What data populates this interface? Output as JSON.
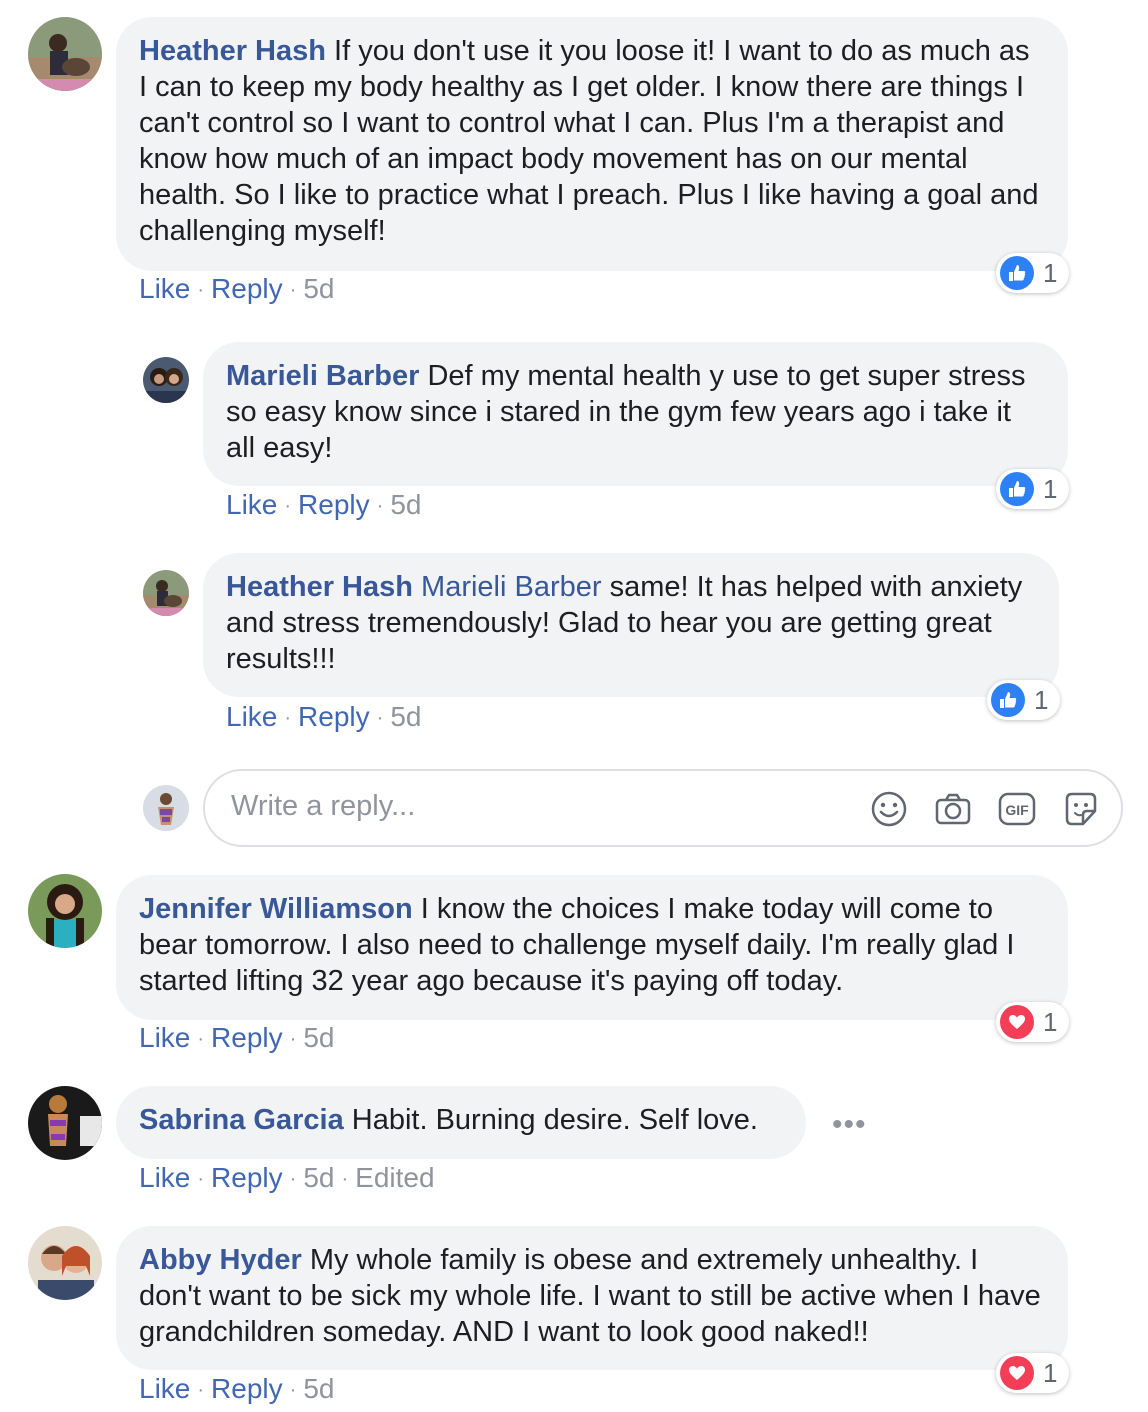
{
  "comments": [
    {
      "author": "Heather Hash",
      "text": " If you don't use it you loose it! I want to do as much as I can to keep my body healthy as I get older. I know there are things I can't control so I want to control what I can. Plus I'm a therapist and know how much of an impact body movement has on our mental health. So I like to practice what I preach. Plus I like having a goal and challenging myself!",
      "actions": {
        "like": "Like",
        "reply": "Reply",
        "time": "5d"
      },
      "reaction": {
        "type": "like",
        "count": "1"
      },
      "replies": [
        {
          "author": "Marieli Barber",
          "text": " Def my mental health y use to get super stress so easy know since i stared in the gym few years ago i take it all easy!",
          "actions": {
            "like": "Like",
            "reply": "Reply",
            "time": "5d"
          },
          "reaction": {
            "type": "like",
            "count": "1"
          }
        },
        {
          "author": "Heather Hash",
          "mention": "Marieli Barber",
          "text": " same! It has helped with anxiety and stress tremendously! Glad to hear you are getting great results!!!",
          "actions": {
            "like": "Like",
            "reply": "Reply",
            "time": "5d"
          },
          "reaction": {
            "type": "like",
            "count": "1"
          }
        }
      ],
      "reply_box": {
        "placeholder": "Write a reply..."
      }
    },
    {
      "author": "Jennifer Williamson",
      "text": " I know the choices I make today will come to bear tomorrow. I also need to challenge myself daily. I'm really glad I started lifting 32 year ago because it's paying off today.",
      "actions": {
        "like": "Like",
        "reply": "Reply",
        "time": "5d"
      },
      "reaction": {
        "type": "love",
        "count": "1"
      }
    },
    {
      "author": "Sabrina Garcia",
      "text": " Habit. Burning desire. Self love.",
      "actions": {
        "like": "Like",
        "reply": "Reply",
        "time": "5d",
        "edited": "Edited"
      },
      "more": "•••"
    },
    {
      "author": "Abby Hyder",
      "text": " My whole family is obese and extremely unhealthy. I don't want to be sick my whole life. I want to still be active when I have grandchildren someday. AND I want to look good naked!!",
      "actions": {
        "like": "Like",
        "reply": "Reply",
        "time": "5d"
      },
      "reaction": {
        "type": "love",
        "count": "1"
      }
    }
  ],
  "separator": "·",
  "colors": {
    "author": "#385898",
    "action": "#4267b2",
    "meta": "#90949c",
    "bubble": "#f2f3f5",
    "like": "#2e81f4",
    "love": "#f33e58"
  },
  "icons": [
    "emoji-icon",
    "camera-icon",
    "gif-icon",
    "sticker-icon",
    "thumbs-up-icon",
    "heart-icon"
  ]
}
